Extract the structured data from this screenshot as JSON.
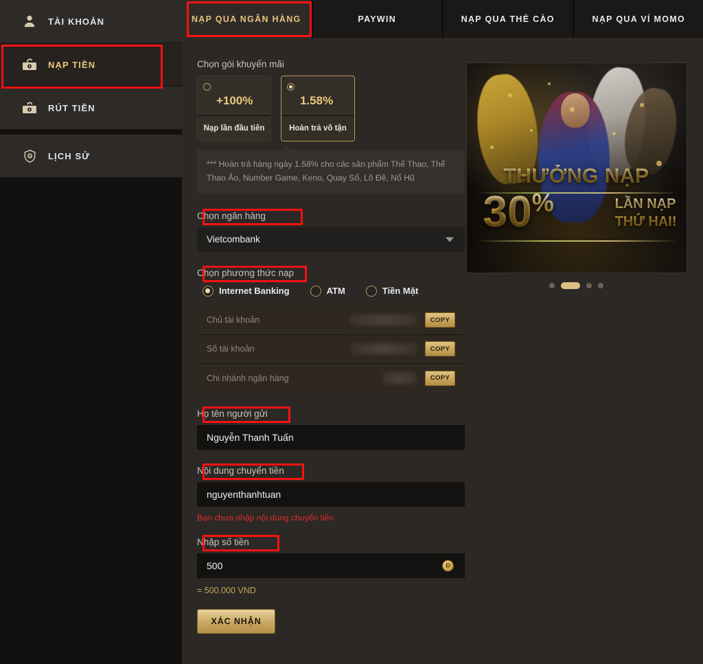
{
  "sidebar": {
    "items": [
      {
        "label": "TÀI KHOẢN",
        "icon": "user-icon",
        "active": false
      },
      {
        "label": "NẠP TIỀN",
        "icon": "deposit-money-icon",
        "active": true
      },
      {
        "label": "RÚT TIỀN",
        "icon": "withdraw-money-icon",
        "active": false
      },
      {
        "label": "LỊCH SỬ",
        "icon": "history-shield-icon",
        "active": false
      }
    ]
  },
  "tabs": [
    {
      "label": "NẠP QUA NGÂN HÀNG",
      "active": true
    },
    {
      "label": "PAYWIN",
      "active": false
    },
    {
      "label": "NẠP QUA THẺ CÀO",
      "active": false
    },
    {
      "label": "NẠP QUA VÍ MOMO",
      "active": false
    }
  ],
  "form": {
    "promo_label": "Chọn gói khuyến mãi",
    "promos": [
      {
        "percent": "+100%",
        "desc": "Nạp lần đầu tiên",
        "selected": false
      },
      {
        "percent": "1.58%",
        "desc": "Hoàn trả vô tận",
        "selected": true
      }
    ],
    "promo_note": "*** Hoàn trả hàng ngày 1.58% cho các sản phẩm Thể Thao, Thể Thao Ảo, Number Game, Keno, Quay Số, Lô Đề, Nổ Hũ",
    "bank_label": "Chọn ngân hàng",
    "bank_value": "Vietcombank",
    "method_label": "Chọn phương thức nạp",
    "methods": [
      {
        "label": "Internet Banking",
        "selected": true
      },
      {
        "label": "ATM",
        "selected": false
      },
      {
        "label": "Tiền Mặt",
        "selected": false
      }
    ],
    "account_rows": [
      {
        "name": "Chủ tài khoản",
        "value": "",
        "copy_label": "COPY"
      },
      {
        "name": "Số tài khoản",
        "value": "",
        "copy_label": "COPY"
      },
      {
        "name": "Chi nhánh ngân hàng",
        "value": "",
        "copy_label": "COPY"
      }
    ],
    "sender_label": "Họ tên người gửi",
    "sender_value": "Nguyễn Thanh Tuấn",
    "content_label": "Nội dung chuyển tiền",
    "content_value": "nguyenthanhtuan",
    "content_error": "Bạn chưa nhập nội dung chuyển tiền",
    "amount_label": "Nhập số tiền",
    "amount_value": "500",
    "amount_currency_icon": "Đ",
    "amount_converted": "= 500.000 VND",
    "submit_label": "XÁC NHẬN"
  },
  "banner": {
    "headline": "THƯỞNG NẠP",
    "big": "30",
    "pct": "%",
    "sub_line1": "LẦN NẠP",
    "sub_line2": "THỨ HAI!",
    "dots": [
      {
        "active": false
      },
      {
        "active": true
      },
      {
        "active": false
      },
      {
        "active": false
      }
    ]
  },
  "colors": {
    "accent_gold": "#e4c27c",
    "highlight_red": "#fb1111",
    "error_red": "#e02c2c",
    "panel_bg": "#2b2825",
    "sidebar_bg": "#131110"
  }
}
